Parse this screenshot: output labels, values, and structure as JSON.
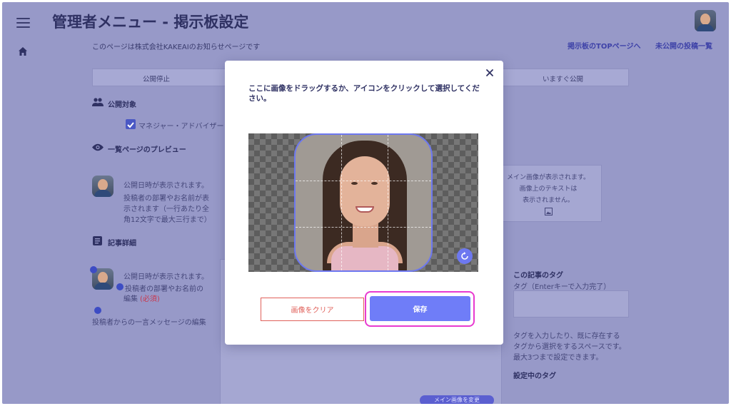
{
  "header": {
    "title": "管理者メニュー - 掲示板設定",
    "subtitle": "このページは株式会社KAKEAIのお知らせページです",
    "links": [
      "掲示板のTOPページへ",
      "未公開の投稿一覧"
    ]
  },
  "nav": {
    "menu_icon": "menu-icon",
    "home_icon": "home-icon"
  },
  "tabs": [
    "公開停止",
    "いますぐ公開"
  ],
  "background": {
    "target_section": "公開対象",
    "target_checkbox_label": "マネジャー・アドバイザー",
    "preview_section": "一覧ページのプレビュー",
    "preview_date_text": "公開日時が表示されます。",
    "preview_author_lines": [
      "投稿者の部署やお名前が表",
      "示されます（一行あたり全",
      "角12文字で最大三行まで）"
    ],
    "detail_section": "記事詳細",
    "detail_date_text": "公開日時が表示されます。",
    "detail_author_lines": [
      "投稿者の部署やお名前の",
      "編集"
    ],
    "required_label": "(必須)",
    "message_edit": "投稿者からの一言メッセージの編集",
    "right_card_lines": [
      "メイン画像が表示されます。",
      "画像上のテキストは",
      "表示されません。"
    ],
    "tag_heading": "この記事のタグ",
    "tag_subheading": "タグ（Enterキーで入力完了）",
    "tag_help_lines": [
      "タグを入力したり、既に存在する",
      "タグから選択をするスペースです。",
      "最大3つまで設定できます。"
    ],
    "current_tags_label": "設定中のタグ",
    "main_image_pill": "メイン画像を変更"
  },
  "modal": {
    "message": "ここに画像をドラッグするか、アイコンをクリックして選択してください。",
    "clear_label": "画像をクリア",
    "save_label": "保存"
  },
  "colors": {
    "overlay_bg": "#9799c8",
    "accent": "#6f7df8",
    "danger": "#e0605a",
    "highlight": "#e83ad0",
    "title": "#2f3163"
  }
}
